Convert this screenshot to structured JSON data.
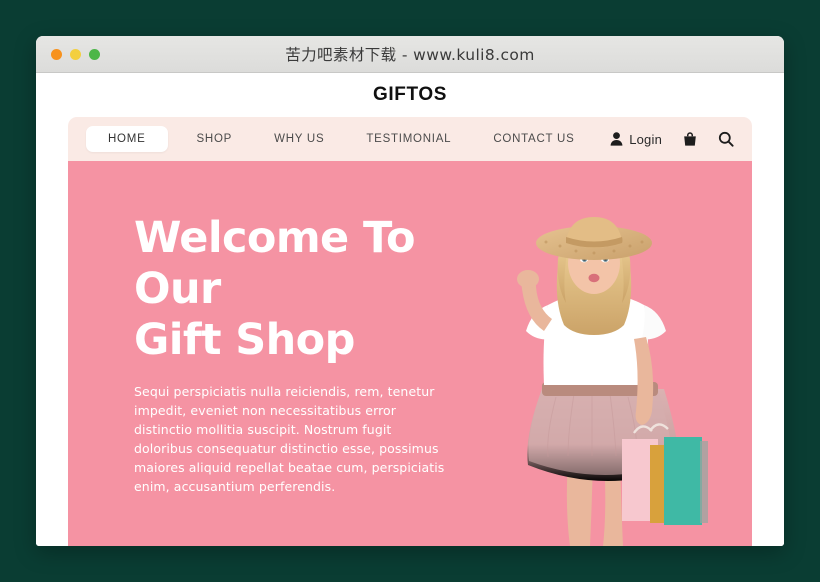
{
  "window": {
    "title": "苦力吧素材下载 - www.kuli8.com",
    "traffic_lights": [
      "close",
      "minimize",
      "maximize"
    ]
  },
  "site": {
    "brand": "GIFTOS",
    "nav": {
      "items": [
        {
          "label": "HOME",
          "active": true
        },
        {
          "label": "SHOP",
          "active": false
        },
        {
          "label": "WHY US",
          "active": false
        },
        {
          "label": "TESTIMONIAL",
          "active": false
        },
        {
          "label": "CONTACT US",
          "active": false
        }
      ],
      "login_label": "Login",
      "icons": [
        "user-icon",
        "shopping-bag-icon",
        "search-icon"
      ]
    },
    "hero": {
      "title_line1": "Welcome To",
      "title_line2": "Our",
      "title_line3": "Gift Shop",
      "paragraph": "Sequi perspiciatis nulla reiciendis, rem, tenetur impedit, eveniet non necessitatibus error distinctio mollitia suscipit. Nostrum fugit doloribus consequatur distinctio esse, possimus maiores aliquid repellat beatae cum, perspiciatis enim, accusantium perferendis.",
      "image_alt": "Girl in straw hat and pink tulle skirt holding shopping bags"
    }
  },
  "colors": {
    "desktop_background": "#0a3d33",
    "titlebar": "#e0e0de",
    "navbar": "#faeae5",
    "hero_pink": "#f593a3",
    "brand_text": "#101010",
    "hero_text": "#ffffff",
    "bag_pink": "#f7c8cf",
    "bag_gold": "#d8a13c",
    "bag_teal": "#3fb9a5",
    "skirt": "#d2a7a7",
    "hat": "#d9b27f"
  }
}
